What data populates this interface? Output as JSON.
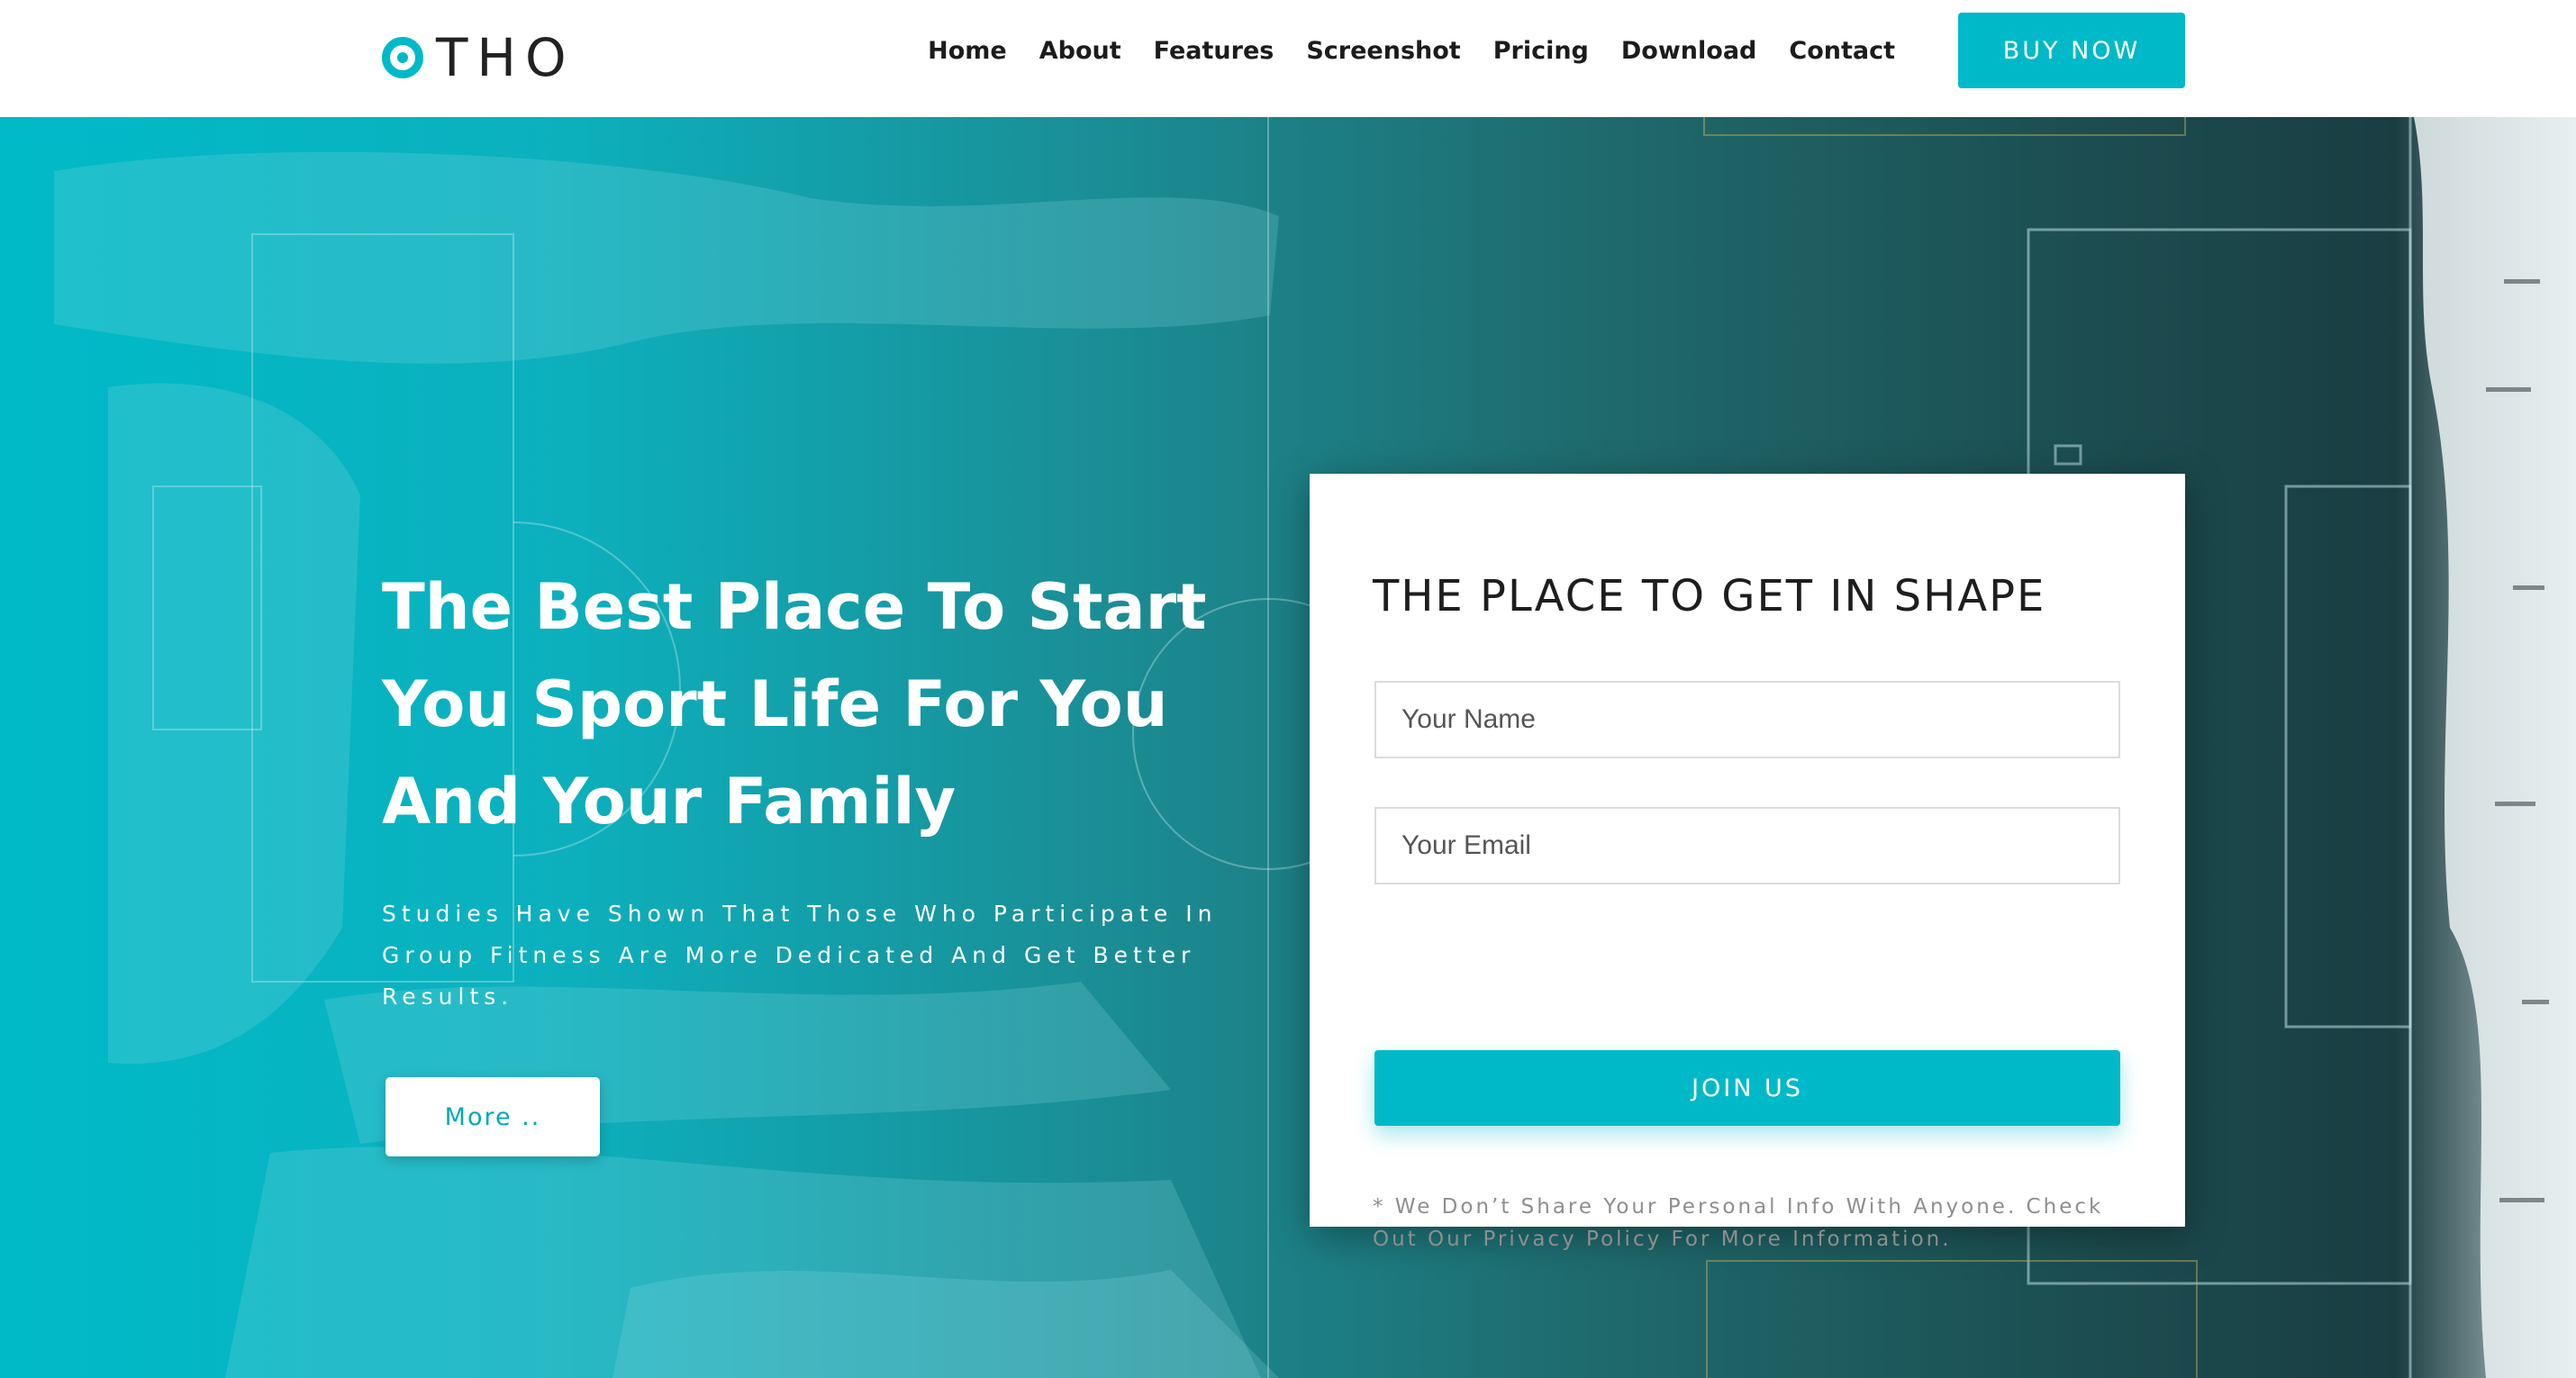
{
  "header": {
    "logo_text": "THO",
    "nav": [
      "Home",
      "About",
      "Features",
      "Screenshot",
      "Pricing",
      "Download",
      "Contact"
    ],
    "buy_label": "BUY NOW"
  },
  "hero": {
    "headline_lines": [
      "The Best Place To Start",
      "You Sport Life For You",
      "And Your Family"
    ],
    "subtext": "Studies Have Shown That Those Who Participate In Group Fitness Are More Dedicated And Get Better Results.",
    "more_label": "More .."
  },
  "form": {
    "title": "THE PLACE TO GET IN SHAPE",
    "name_placeholder": "Your Name",
    "email_placeholder": "Your Email",
    "join_label": "JOIN US",
    "disclaimer": "* We Don’t Share Your Personal Info With Anyone. Check Out Our Privacy Policy For More Information."
  },
  "colors": {
    "accent": "#00b9c8",
    "text_dark": "#1c1c1c",
    "muted": "#8e8e8e"
  }
}
